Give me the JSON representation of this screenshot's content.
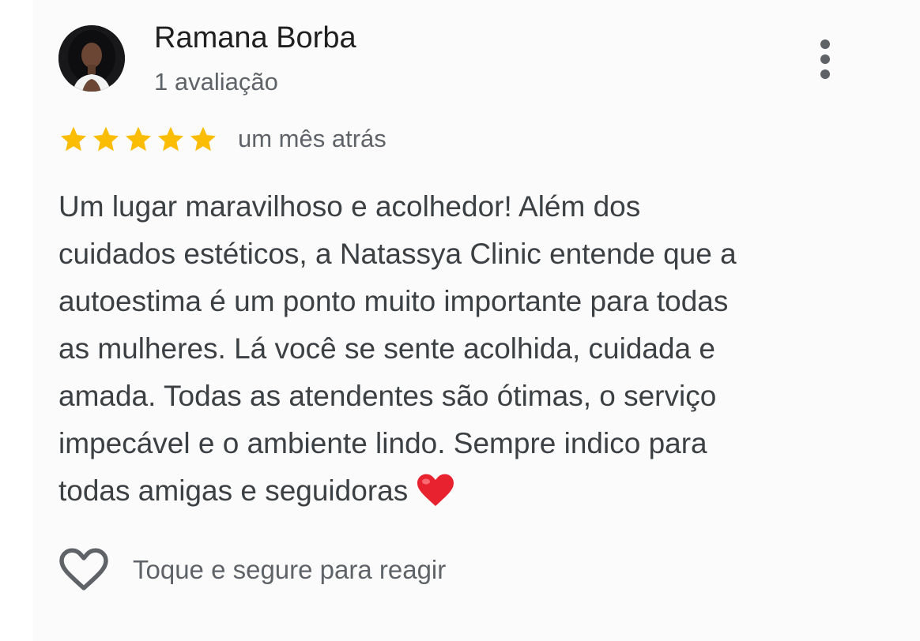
{
  "review": {
    "author_name": "Ramana Borba",
    "author_meta": "1 avaliação",
    "rating": 5,
    "rating_max": 5,
    "date": "um mês atrás",
    "text_lines": [
      "Um lugar maravilhoso e acolhedor! Além dos",
      "cuidados estéticos, a Natassya Clinic entende que a",
      "autoestima é um ponto muito importante para todas",
      "as mulheres. Lá você se sente acolhida, cuidada e",
      "amada. Todas as atendentes são ótimas, o serviço",
      "impecável e o ambiente lindo. Sempre indico para",
      "todas amigas e seguidoras"
    ],
    "emoji": "red-heart-emoji"
  },
  "actions": {
    "menu_icon": "more-vert-icon",
    "react_icon": "heart-outline-icon",
    "react_label": "Toque e segure para reagir"
  },
  "colors": {
    "star": "#FBBC04",
    "secondary_text": "#5f6368",
    "body_text": "#3c4043",
    "emoji_heart": "#e8232f"
  }
}
